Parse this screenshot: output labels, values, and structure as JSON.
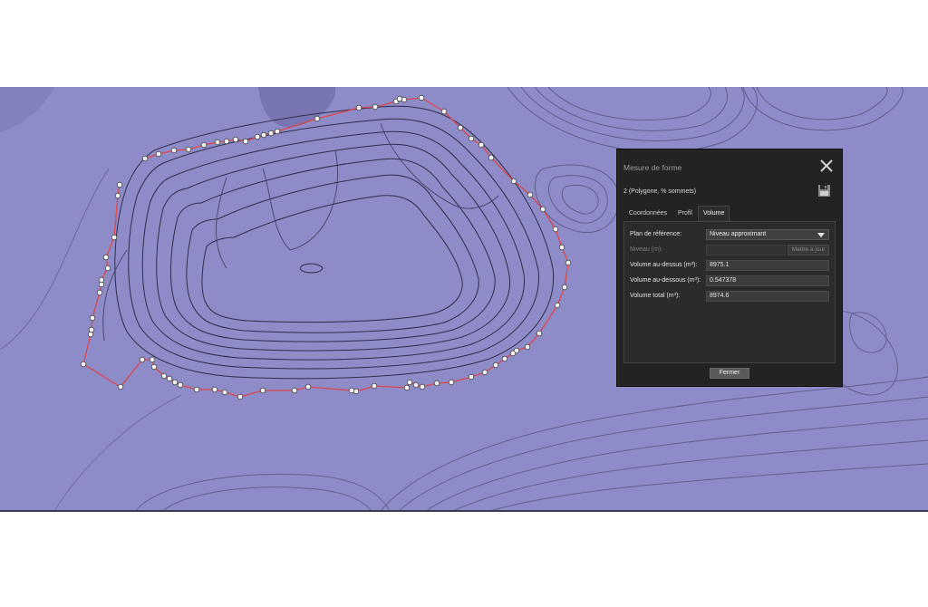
{
  "panel": {
    "title": "Mesure de forme",
    "subtitle": "2 (Polygone, % sommets)",
    "close_icon": "close-icon",
    "save_icon": "floppy-disk-icon",
    "tabs": [
      {
        "label": "Coordonnées",
        "active": false
      },
      {
        "label": "Profil",
        "active": false
      },
      {
        "label": "Volume",
        "active": true
      }
    ],
    "fields": {
      "reference_label": "Plan de référence:",
      "reference_value": "Niveau approximant",
      "level_label": "Niveau (m):",
      "update_label": "Mettre à jour",
      "above_label": "Volume au-dessus (m³):",
      "above_value": "8975.1",
      "below_label": "Volume au-dessous (m³):",
      "below_value": "0.547378",
      "total_label": "Volume total (m³):",
      "total_value": "8974.6"
    },
    "close_button_label": "Fermer"
  },
  "colors": {
    "map_background": "#8d8bc8",
    "polygon_outline": "#e0464a",
    "vertex_fill": "#f4f4f4",
    "panel_background": "#232323"
  }
}
